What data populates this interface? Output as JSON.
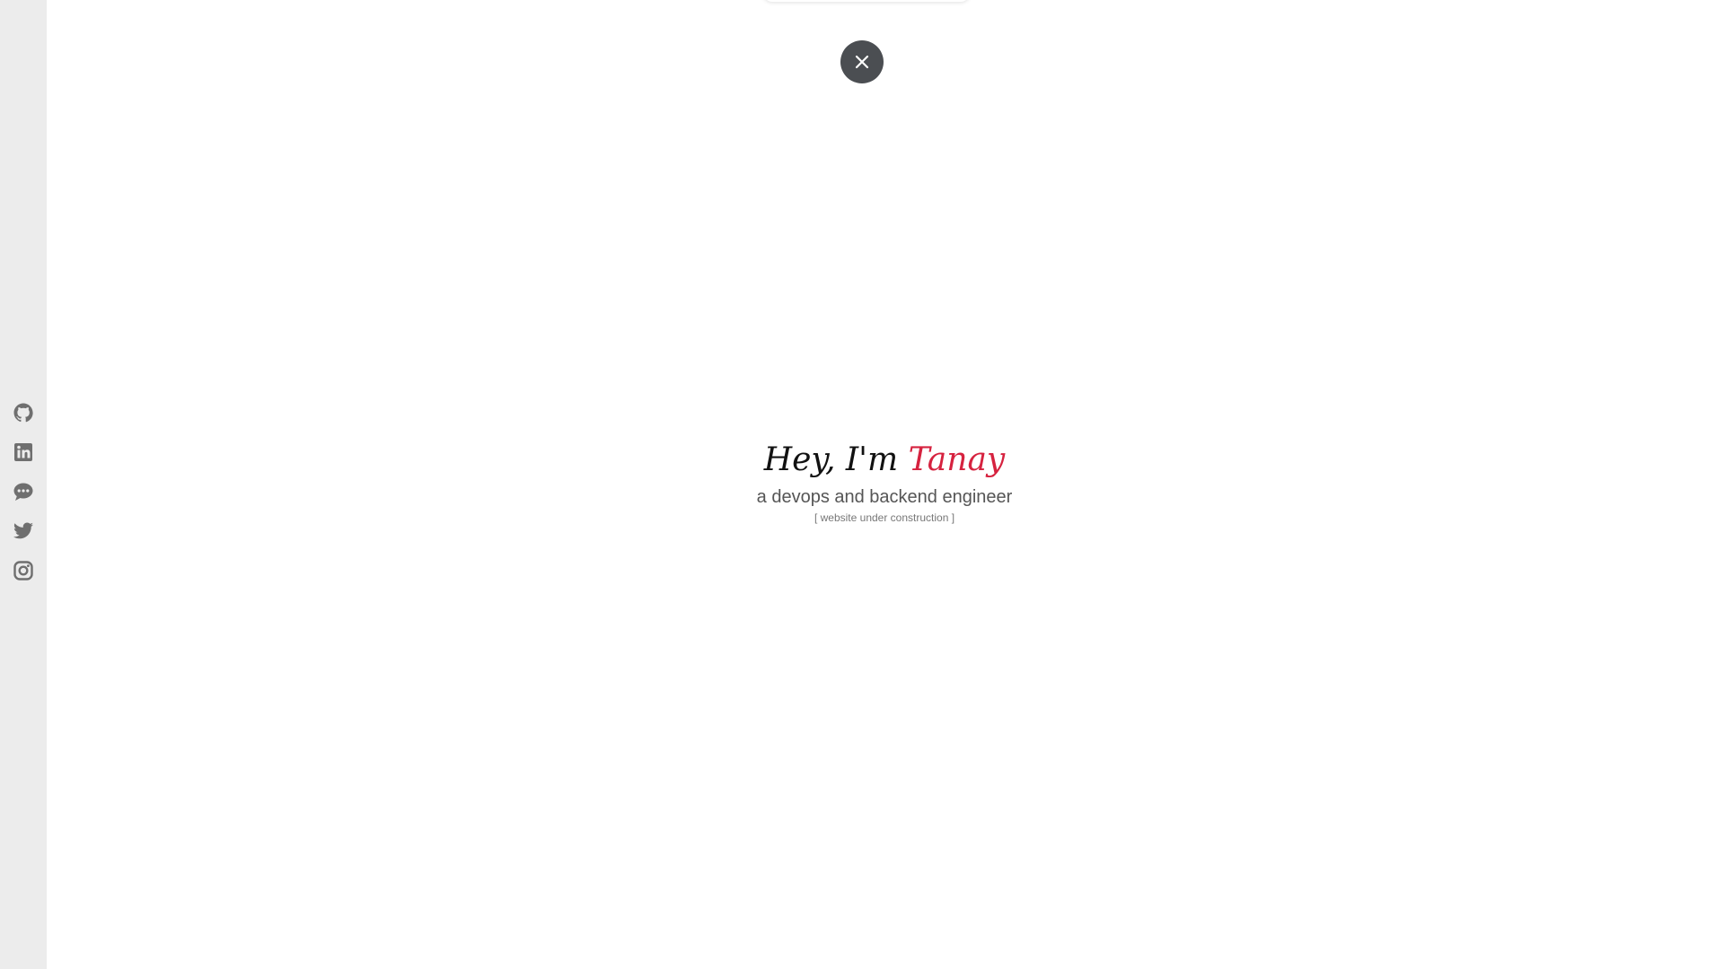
{
  "sidebar": {
    "social_links": [
      {
        "icon": "github-icon"
      },
      {
        "icon": "linkedin-icon"
      },
      {
        "icon": "chat-icon"
      },
      {
        "icon": "twitter-icon"
      },
      {
        "icon": "instagram-icon"
      }
    ]
  },
  "close_button": {
    "icon": "close-icon"
  },
  "hero": {
    "greeting_prefix": "Hey, I'm ",
    "name": "Tanay",
    "tagline": "a devops and backend engineer",
    "note": "[ website under construction ]"
  },
  "colors": {
    "accent": "#d6223f",
    "sidebar_background": "#ececec",
    "icon": "#6f6f6f",
    "close_button": "#4b4e52"
  }
}
